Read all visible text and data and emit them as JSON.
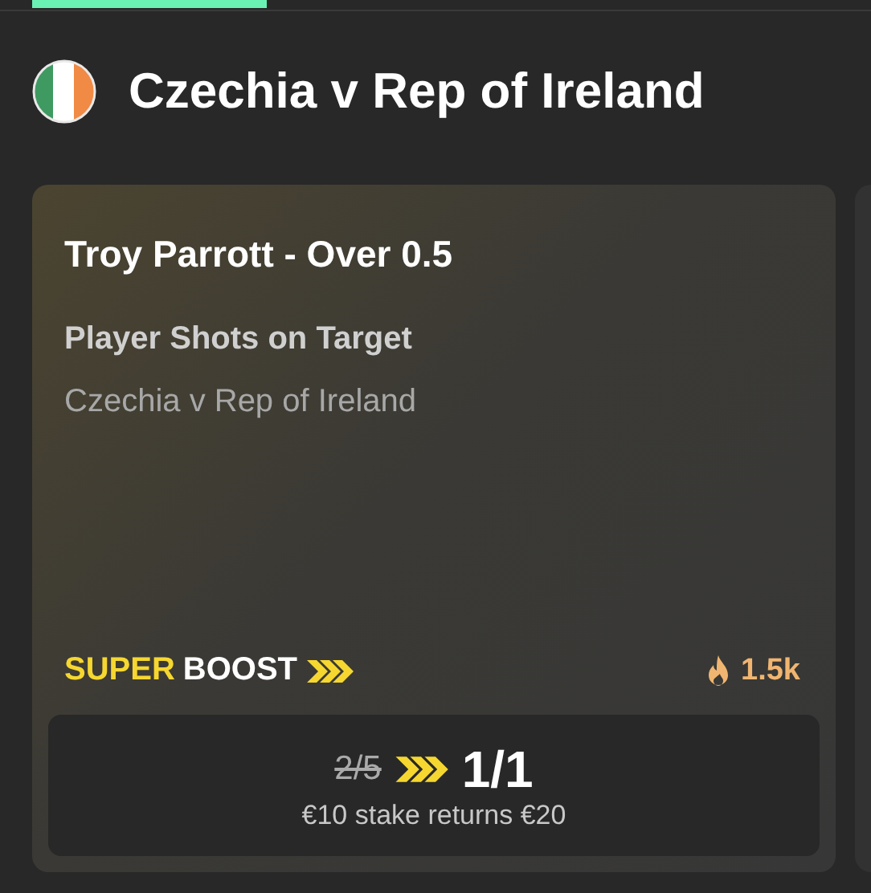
{
  "event": {
    "title": "Czechia v Rep of Ireland"
  },
  "card": {
    "selection": "Troy Parrott - Over 0.5",
    "market": "Player Shots on Target",
    "event": "Czechia v Rep of Ireland",
    "boost": {
      "highlight": "SUPER",
      "label": "BOOST"
    },
    "popularity": "1.5k",
    "old_price": "2/5",
    "new_price": "1/1",
    "returns": "€10 stake returns €20"
  }
}
